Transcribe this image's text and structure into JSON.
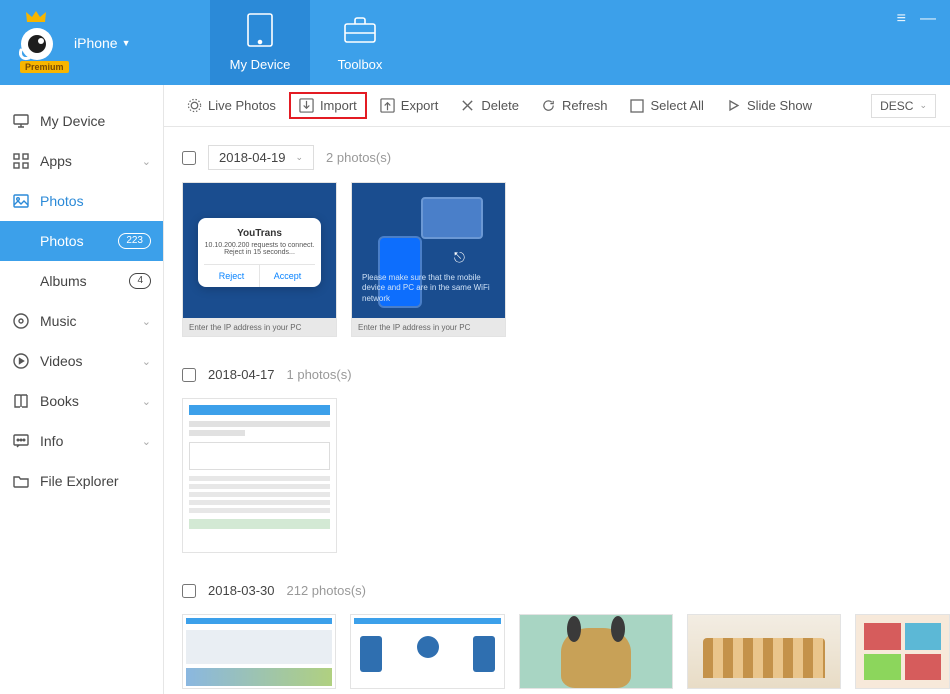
{
  "header": {
    "device_label": "iPhone",
    "premium_label": "Premium",
    "tabs": {
      "my_device": "My Device",
      "toolbox": "Toolbox"
    }
  },
  "sidebar": {
    "my_device": "My Device",
    "apps": "Apps",
    "photos": "Photos",
    "photos_sub": "Photos",
    "photos_count": "223",
    "albums": "Albums",
    "albums_count": "4",
    "music": "Music",
    "videos": "Videos",
    "books": "Books",
    "info": "Info",
    "file_explorer": "File Explorer"
  },
  "toolbar": {
    "live_photos": "Live Photos",
    "import": "Import",
    "export": "Export",
    "delete": "Delete",
    "refresh": "Refresh",
    "select_all": "Select All",
    "slide_show": "Slide Show",
    "sort": "DESC"
  },
  "groups": [
    {
      "date": "2018-04-19",
      "count_text": "2 photos(s)",
      "has_dropdown": true
    },
    {
      "date": "2018-04-17",
      "count_text": "1 photos(s)",
      "has_dropdown": false
    },
    {
      "date": "2018-03-30",
      "count_text": "212 photos(s)",
      "has_dropdown": false
    }
  ],
  "mock": {
    "dialog_title": "YouTrans",
    "dialog_sub": "10.10.200.200 requests to connect. Reject in 15 seconds...",
    "dialog_reject": "Reject",
    "dialog_accept": "Accept",
    "wifi_caption": "Please make sure that the mobile device and PC are in the same WiFi network",
    "ip_caption": "Enter the IP address in your PC"
  }
}
